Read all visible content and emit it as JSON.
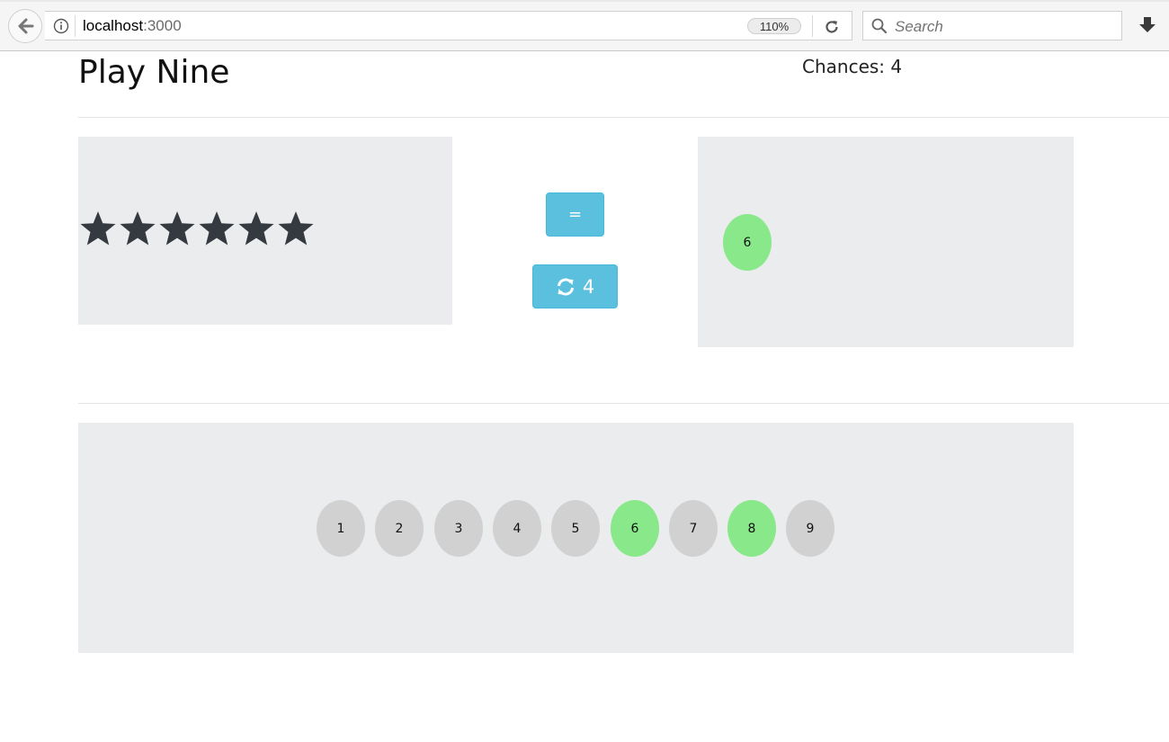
{
  "browser": {
    "url_host": "localhost",
    "url_port": ":3000",
    "zoom": "110%",
    "search_placeholder": "Search",
    "icons": [
      "back-arrow-icon",
      "info-icon",
      "reload-icon",
      "search-icon",
      "download-icon"
    ]
  },
  "game": {
    "title": "Play Nine",
    "chances_label": "Chances: 4",
    "star_count": 6,
    "check_label": "=",
    "redraw_count": "4",
    "answer_numbers": [
      "6"
    ],
    "numbers": [
      {
        "label": "1",
        "state": "available"
      },
      {
        "label": "2",
        "state": "available"
      },
      {
        "label": "3",
        "state": "available"
      },
      {
        "label": "4",
        "state": "available"
      },
      {
        "label": "5",
        "state": "available"
      },
      {
        "label": "6",
        "state": "selected"
      },
      {
        "label": "7",
        "state": "available"
      },
      {
        "label": "8",
        "state": "selected"
      },
      {
        "label": "9",
        "state": "available"
      }
    ]
  },
  "colors": {
    "button": "#5bc0de",
    "selected": "#88e88a",
    "available": "#d1d1d1",
    "frame": "#ebeced",
    "star": "#343a40"
  }
}
